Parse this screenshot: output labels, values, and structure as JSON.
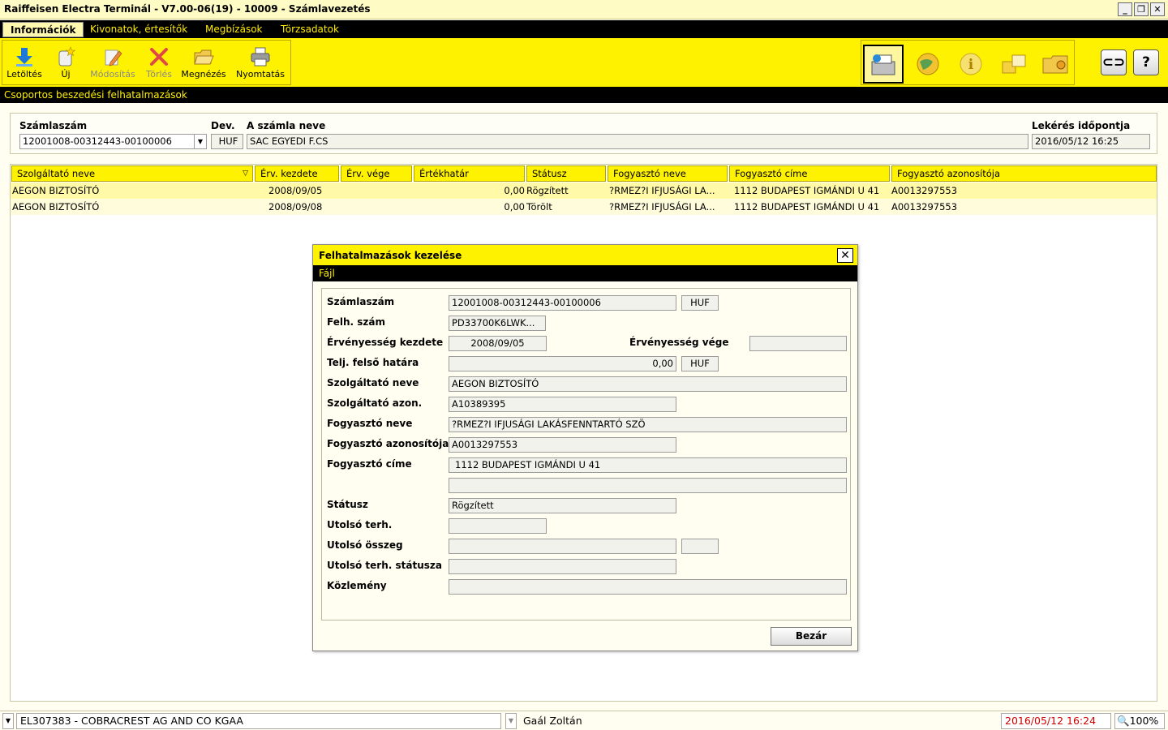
{
  "window": {
    "title": "Raiffeisen Electra Terminál - V7.00-06(19) - 10009 - Számlavezetés"
  },
  "menu": [
    "Információk",
    "Kivonatok, értesítők",
    "Megbízások",
    "Törzsadatok"
  ],
  "toolbar": {
    "download": "Letöltés",
    "new": "Új",
    "modify": "Módosítás",
    "delete": "Törlés",
    "view": "Megnézés",
    "print": "Nyomtatás"
  },
  "section_title": "Csoportos beszedési felhatalmazások",
  "account": {
    "number_label": "Számlaszám",
    "number": "12001008-00312443-00100006",
    "currency_label": "Dev.",
    "currency": "HUF",
    "name_label": "A számla neve",
    "name": "SAC EGYEDI F.CS",
    "query_time_label": "Lekérés időpontja",
    "query_time": "2016/05/12 16:25"
  },
  "table": {
    "headers": [
      "Szolgáltató neve",
      "Érv. kezdete",
      "Érv. vége",
      "Értékhatár",
      "Státusz",
      "Fogyasztó neve",
      "Fogyasztó címe",
      "Fogyasztó azonosítója"
    ],
    "rows": [
      {
        "provider": "AEGON BIZTOSÍTÓ",
        "start": "2008/09/05",
        "end": "",
        "limit": "0,00",
        "status": "Rögzített",
        "consumer": "?RMEZ?I IFJUSÁGI LA...",
        "address": "1112 BUDAPEST IGMÁNDI U 41",
        "consumer_id": "A0013297553"
      },
      {
        "provider": "AEGON BIZTOSÍTÓ",
        "start": "2008/09/08",
        "end": "",
        "limit": "0,00",
        "status": "Törölt",
        "consumer": "?RMEZ?I IFJUSÁGI LA...",
        "address": "1112 BUDAPEST IGMÁNDI U 41",
        "consumer_id": "A0013297553"
      }
    ]
  },
  "dialog": {
    "title": "Felhatalmazások kezelése",
    "menu": "Fájl",
    "labels": {
      "account": "Számlaszám",
      "auth_no": "Felh. szám",
      "valid_from": "Érvényesség kezdete",
      "valid_to": "Érvényesség vége",
      "limit": "Telj. felső határa",
      "provider_name": "Szolgáltató neve",
      "provider_id": "Szolgáltató azon.",
      "consumer_name": "Fogyasztó neve",
      "consumer_id": "Fogyasztó azonosítója",
      "consumer_address": "Fogyasztó címe",
      "status": "Státusz",
      "last_debit": "Utolsó terh.",
      "last_amount": "Utolsó összeg",
      "last_debit_status": "Utolsó terh. státusza",
      "note": "Közlemény"
    },
    "values": {
      "account": "12001008-00312443-00100006",
      "account_currency": "HUF",
      "auth_no": "PD33700K6LWK...",
      "valid_from": "2008/09/05",
      "valid_to": "",
      "limit": "0,00",
      "limit_currency": "HUF",
      "provider_name": "AEGON BIZTOSÍTÓ",
      "provider_id": "A10389395",
      "consumer_name": "?RMEZ?I IFJUSÁGI LAKÁSFENNTARTÓ SZÖ",
      "consumer_id": "A0013297553",
      "consumer_address": "1112 BUDAPEST IGMÁNDI U 41",
      "consumer_address2": "",
      "status": "Rögzített",
      "last_debit": "",
      "last_amount": "",
      "last_amount_currency": "",
      "last_debit_status": "",
      "note": ""
    },
    "close_button": "Bezár"
  },
  "status_bar": {
    "company": "EL307383 - COBRACREST AG AND CO KGAA",
    "user": "Gaál Zoltán",
    "datetime": "2016/05/12 16:24",
    "zoom": "100%"
  },
  "colors": {
    "accent": "#fff200",
    "bar": "#000000",
    "datetime": "#cc0000"
  }
}
